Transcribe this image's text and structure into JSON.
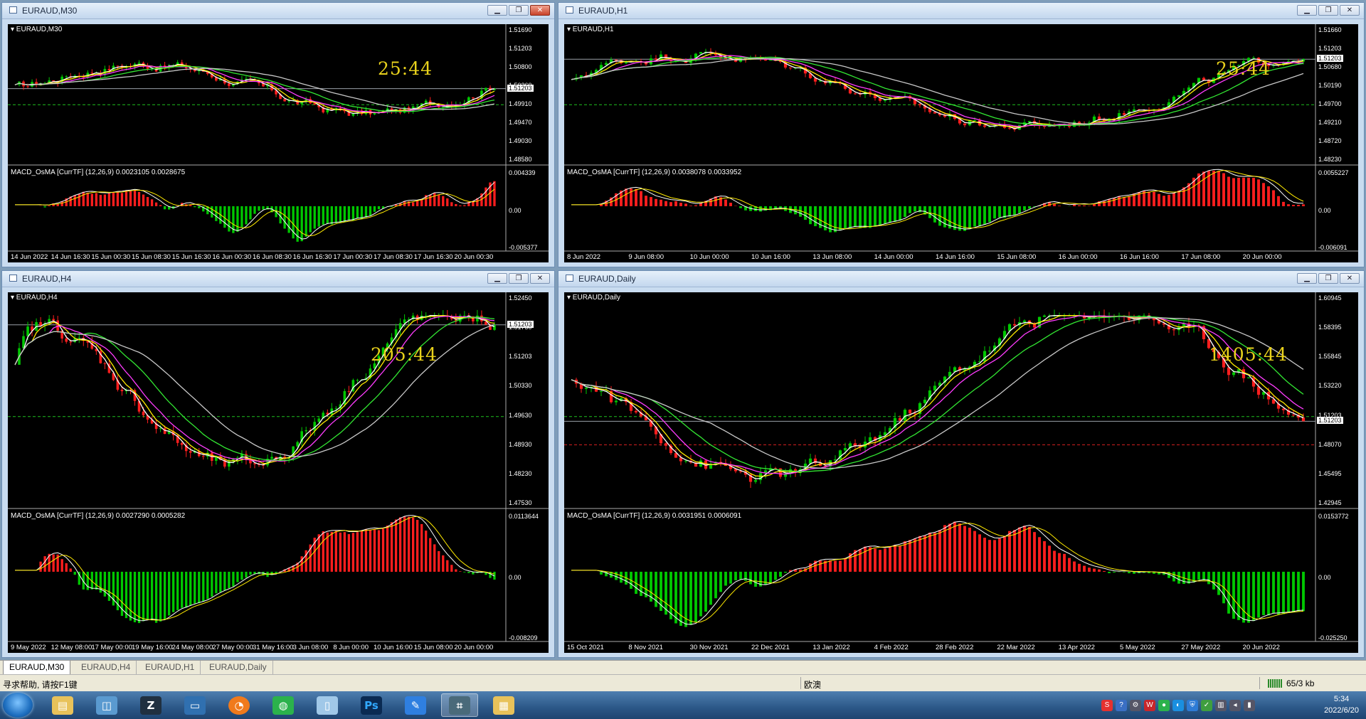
{
  "windows": [
    {
      "id": "m30",
      "title": "EURAUD,M30",
      "symbol_label": "EURAUD,M30",
      "macd_label": "MACD_OsMA [CurrTF] (12,26,9) 0.0023105 0.0028675",
      "timer": "25:44",
      "price_ticks": [
        "1.51690",
        "1.51203",
        "1.50800",
        "1.50360",
        "1.49910",
        "1.49470",
        "1.49030",
        "1.48580"
      ],
      "current_price": "1.51203",
      "macd_ticks": [
        "0.004339",
        "0.00",
        "-0.005377"
      ],
      "time_labels": [
        "14 Jun 2022",
        "14 Jun 16:30",
        "15 Jun 00:30",
        "15 Jun 08:30",
        "15 Jun 16:30",
        "16 Jun 00:30",
        "16 Jun 08:30",
        "16 Jun 16:30",
        "17 Jun 00:30",
        "17 Jun 08:30",
        "17 Jun 16:30",
        "20 Jun 00:30"
      ]
    },
    {
      "id": "h1",
      "title": "EURAUD,H1",
      "symbol_label": "EURAUD,H1",
      "macd_label": "MACD_OsMA [CurrTF] (12,26,9) 0.0038078 0.0033952",
      "timer": "25:44",
      "price_ticks": [
        "1.51660",
        "1.51203",
        "1.50680",
        "1.50190",
        "1.49700",
        "1.49210",
        "1.48720",
        "1.48230"
      ],
      "current_price": "1.51203",
      "macd_ticks": [
        "0.0055227",
        "0.00",
        "-0.006091"
      ],
      "time_labels": [
        "8 Jun 2022",
        "9 Jun 08:00",
        "10 Jun 00:00",
        "10 Jun 16:00",
        "13 Jun 08:00",
        "14 Jun 00:00",
        "14 Jun 16:00",
        "15 Jun 08:00",
        "16 Jun 00:00",
        "16 Jun 16:00",
        "17 Jun 08:00",
        "20 Jun 00:00"
      ]
    },
    {
      "id": "h4",
      "title": "EURAUD,H4",
      "symbol_label": "EURAUD,H4",
      "macd_label": "MACD_OsMA [CurrTF] (12,26,9) 0.0027290 0.0005282",
      "timer": "205:44",
      "price_ticks": [
        "1.52450",
        "1.51730",
        "1.51203",
        "1.50330",
        "1.49630",
        "1.48930",
        "1.48230",
        "1.47530"
      ],
      "current_price": "1.51203",
      "macd_ticks": [
        "0.0113644",
        "0.00",
        "-0.008209"
      ],
      "time_labels": [
        "9 May 2022",
        "12 May 08:00",
        "17 May 00:00",
        "19 May 16:00",
        "24 May 08:00",
        "27 May 00:00",
        "31 May 16:00",
        "3 Jun 08:00",
        "8 Jun 00:00",
        "10 Jun 16:00",
        "15 Jun 08:00",
        "20 Jun 00:00"
      ]
    },
    {
      "id": "d1",
      "title": "EURAUD,Daily",
      "symbol_label": "EURAUD,Daily",
      "macd_label": "MACD_OsMA [CurrTF] (12,26,9) 0.0031951 0.0006091",
      "timer": "1405:44",
      "price_ticks": [
        "1.60945",
        "1.58395",
        "1.55845",
        "1.53220",
        "1.51203",
        "1.48070",
        "1.45495",
        "1.42945"
      ],
      "current_price": "1.51203",
      "macd_ticks": [
        "0.0153772",
        "0.00",
        "-0.025250"
      ],
      "time_labels": [
        "15 Oct 2021",
        "8 Nov 2021",
        "30 Nov 2021",
        "22 Dec 2021",
        "13 Jan 2022",
        "4 Feb 2022",
        "28 Feb 2022",
        "22 Mar 2022",
        "13 Apr 2022",
        "5 May 2022",
        "27 May 2022",
        "20 Jun 2022"
      ]
    }
  ],
  "tabs": [
    "EURAUD,M30",
    "EURAUD,H4",
    "EURAUD,H1",
    "EURAUD,Daily"
  ],
  "active_tab": "EURAUD,M30",
  "status": {
    "help_text": "寻求帮助, 请按F1键",
    "profile": "欧澳",
    "traffic": "65/3 kb"
  },
  "clock": {
    "time": "5:34",
    "date": "2022/6/20"
  },
  "taskbar_apps": [
    "folder",
    "remote",
    "terminal",
    "display",
    "fox",
    "wechat",
    "notebook",
    "photoshop",
    "notes",
    "mt4",
    "explorer"
  ],
  "colors": {
    "bull": "#00c800",
    "bear": "#ff1e1e",
    "ma_white": "#ffffff",
    "ma_yellow": "#ffea00",
    "ma_magenta": "#ff3cff",
    "ma_green": "#32e632",
    "ma_gray": "#c8c8c8",
    "timer": "#e8d11c"
  }
}
